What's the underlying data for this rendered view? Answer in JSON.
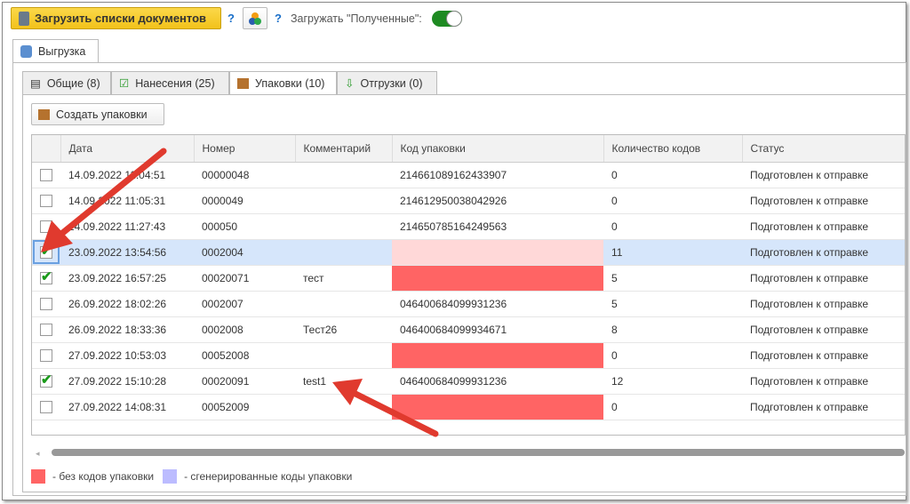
{
  "toolbar": {
    "load_button": "Загрузить списки документов",
    "help": "?",
    "help2": "?",
    "toggle_label": "Загружать \"Полученные\":",
    "toggle_on": true
  },
  "outer_tab": "Выгрузка",
  "tabs": [
    {
      "label": "Общие (8)"
    },
    {
      "label": "Нанесения (25)"
    },
    {
      "label": "Упаковки (10)",
      "active": true
    },
    {
      "label": "Отгрузки (0)"
    }
  ],
  "create_button": "Создать упаковки",
  "columns": [
    "Дата",
    "Номер",
    "Комментарий",
    "Код упаковки",
    "Количество кодов",
    "Статус"
  ],
  "rows": [
    {
      "checked": false,
      "date": "14.09.2022 11:04:51",
      "number": "00000048",
      "comment": "",
      "code": "214661089162433907",
      "count": "0",
      "status": "Подготовлен к отправке",
      "no_code": false
    },
    {
      "checked": false,
      "date": "14.09.2022 11:05:31",
      "number": "0000049",
      "comment": "",
      "code": "214612950038042926",
      "count": "0",
      "status": "Подготовлен к отправке",
      "no_code": false
    },
    {
      "checked": false,
      "date": "14.09.2022 11:27:43",
      "number": "000050",
      "comment": "",
      "code": "214650785164249563",
      "count": "0",
      "status": "Подготовлен к отправке",
      "no_code": false
    },
    {
      "checked": true,
      "selected": true,
      "date": "23.09.2022 13:54:56",
      "number": "0002004",
      "comment": "",
      "code": "",
      "count": "11",
      "status": "Подготовлен к отправке",
      "no_code": true
    },
    {
      "checked": true,
      "date": "23.09.2022 16:57:25",
      "number": "00020071",
      "comment": "тест",
      "code": "",
      "count": "5",
      "status": "Подготовлен к отправке",
      "no_code": true
    },
    {
      "checked": false,
      "date": "26.09.2022 18:02:26",
      "number": "0002007",
      "comment": "",
      "code": "046400684099931236",
      "count": "5",
      "status": "Подготовлен к отправке",
      "no_code": false
    },
    {
      "checked": false,
      "date": "26.09.2022 18:33:36",
      "number": "0002008",
      "comment": "Тест26",
      "code": "046400684099934671",
      "count": "8",
      "status": "Подготовлен к отправке",
      "no_code": false
    },
    {
      "checked": false,
      "date": "27.09.2022 10:53:03",
      "number": "00052008",
      "comment": "",
      "code": "",
      "count": "0",
      "status": "Подготовлен к отправке",
      "no_code": true
    },
    {
      "checked": true,
      "date": "27.09.2022 15:10:28",
      "number": "00020091",
      "comment": "test1",
      "code": "046400684099931236",
      "count": "12",
      "status": "Подготовлен к отправке",
      "no_code": false
    },
    {
      "checked": false,
      "date": "27.09.2022 14:08:31",
      "number": "00052009",
      "comment": "",
      "code": "",
      "count": "0",
      "status": "Подготовлен к отправке",
      "no_code": true
    }
  ],
  "legend": [
    {
      "color": "#ff6464",
      "label": "- без кодов упаковки"
    },
    {
      "color": "#bcbcff",
      "label": "- сгенерированные коды упаковки"
    }
  ],
  "colors": {
    "no_code": "#ff6464",
    "selected_row": "#d6e6fb",
    "arrow": "#e03a2e",
    "toggle": "#1e8a22",
    "load_button": "#f2c21a"
  }
}
